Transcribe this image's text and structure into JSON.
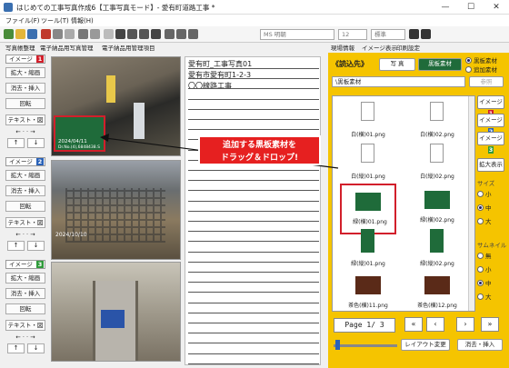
{
  "window": {
    "title": "はじめての工事写真作成6【工事写真モード】- 愛有町道路工事 *",
    "min": "—",
    "max": "☐",
    "close": "✕"
  },
  "menu": [
    "ファイル(F)",
    "ツール(T)",
    "情報(H)"
  ],
  "toolbar": {
    "font": "MS 明朝",
    "size": "12",
    "style": "標準"
  },
  "tabs": [
    "写真帳整理",
    "電子納品用写真管理",
    "電子納品用管理項目"
  ],
  "right_tabs": [
    "現場情報",
    "イメージ表示",
    "印刷設定"
  ],
  "left_groups": [
    {
      "label": "イメージ",
      "num": "1",
      "color": "#d21f2b",
      "buttons": [
        "拡大・縮画",
        "消去・挿入",
        "回転",
        "テキスト・図"
      ]
    },
    {
      "label": "イメージ",
      "num": "2",
      "color": "#2a62b8",
      "buttons": [
        "拡大・縮画",
        "消去・挿入",
        "回転",
        "テキスト・図"
      ]
    },
    {
      "label": "イメージ",
      "num": "3",
      "color": "#2f9a3a",
      "buttons": [
        "拡大・縮画",
        "消去・挿入",
        "回転",
        "テキスト・図"
      ]
    }
  ],
  "arrows": {
    "left": "←",
    "right": "→",
    "up": "↑",
    "down": "↓",
    "lr": "← · · →"
  },
  "photo_texts": {
    "line1": "愛有町_工事写真01",
    "line2": "愛有市愛有町1-2-3",
    "line3": "〇〇線路工事"
  },
  "board_overlay": {
    "date": "2024/04/11",
    "text": "Dr.No.(4),6848438.S"
  },
  "photo2_date": "2024/10/10",
  "panel": {
    "read_button": "《読込先》",
    "photo_btn": "写 真",
    "board_btn": "黒板素材",
    "radio1": "黒板素材",
    "radio2": "追加素材",
    "path": "\\黒板素材",
    "refer": "参照",
    "cells": [
      "白(横)01.png",
      "白(横)02.png",
      "白(縦)01.png",
      "白(縦)02.png",
      "緑(横)01.png",
      "緑(横)02.png",
      "緑(縦)01.png",
      "緑(縦)02.png",
      "茶色(横)11.png",
      "茶色(横)12.png"
    ],
    "image_tabs": [
      {
        "label": "イメージ",
        "num": "1",
        "color": "#d21f2b"
      },
      {
        "label": "イメージ",
        "num": "2",
        "color": "#2a62b8"
      },
      {
        "label": "イメージ",
        "num": "3",
        "color": "#2f9a3a"
      }
    ],
    "enlarge": "拡大表示",
    "size_label": "サイズ",
    "sizes": [
      "小",
      "中",
      "大"
    ],
    "thumb_label": "サムネイル",
    "thumbs": [
      "無",
      "小",
      "中",
      "大"
    ],
    "page": "Page 1/ 3",
    "layout_btn": "レイアウト変更",
    "remove_btn": "消去・挿入"
  },
  "nav": {
    "first": "«",
    "prev": "‹",
    "next": "›",
    "last": "»"
  },
  "callout": "追加する黒板素材を\nドラッグ＆ドロップ!",
  "colors": {
    "panel": "#f5c400",
    "board_green": "#1f6b3a",
    "board_brown": "#5a2a18",
    "highlight": "#d21f2b"
  }
}
